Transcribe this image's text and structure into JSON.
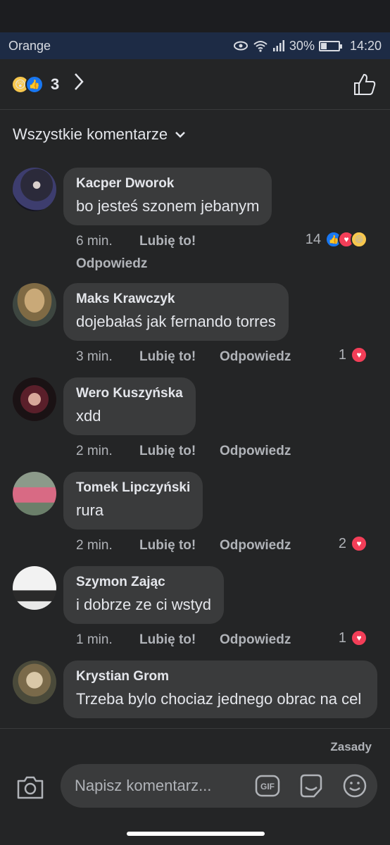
{
  "status": {
    "carrier": "Orange",
    "battery": "30%",
    "time": "14:20"
  },
  "reactions": {
    "count": "3"
  },
  "filter": {
    "label": "Wszystkie komentarze"
  },
  "comments": [
    {
      "author": "Kacper Dworok",
      "text": "bo jesteś szonem jebanym",
      "time": "6 min.",
      "like": "Lubię to!",
      "reply": "Odpowiedz",
      "reaction_count": "14"
    },
    {
      "author": "Maks Krawczyk",
      "text": "dojebałaś jak fernando torres",
      "time": "3 min.",
      "like": "Lubię to!",
      "reply": "Odpowiedz",
      "reaction_count": "1"
    },
    {
      "author": "Wero Kuszyńska",
      "text": "xdd",
      "time": "2 min.",
      "like": "Lubię to!",
      "reply": "Odpowiedz",
      "reaction_count": ""
    },
    {
      "author": "Tomek Lipczyński",
      "text": "rura",
      "time": "2 min.",
      "like": "Lubię to!",
      "reply": "Odpowiedz",
      "reaction_count": "2"
    },
    {
      "author": "Szymon Zając",
      "text": "i dobrze ze ci wstyd",
      "time": "1 min.",
      "like": "Lubię to!",
      "reply": "Odpowiedz",
      "reaction_count": "1"
    },
    {
      "author": "Krystian Grom",
      "text": "Trzeba bylo chociaz jednego obrac na cel",
      "time": "",
      "like": "",
      "reply": "",
      "reaction_count": ""
    }
  ],
  "composer": {
    "policy": "Zasady",
    "placeholder": "Napisz komentarz...",
    "gif_label": "GIF"
  }
}
